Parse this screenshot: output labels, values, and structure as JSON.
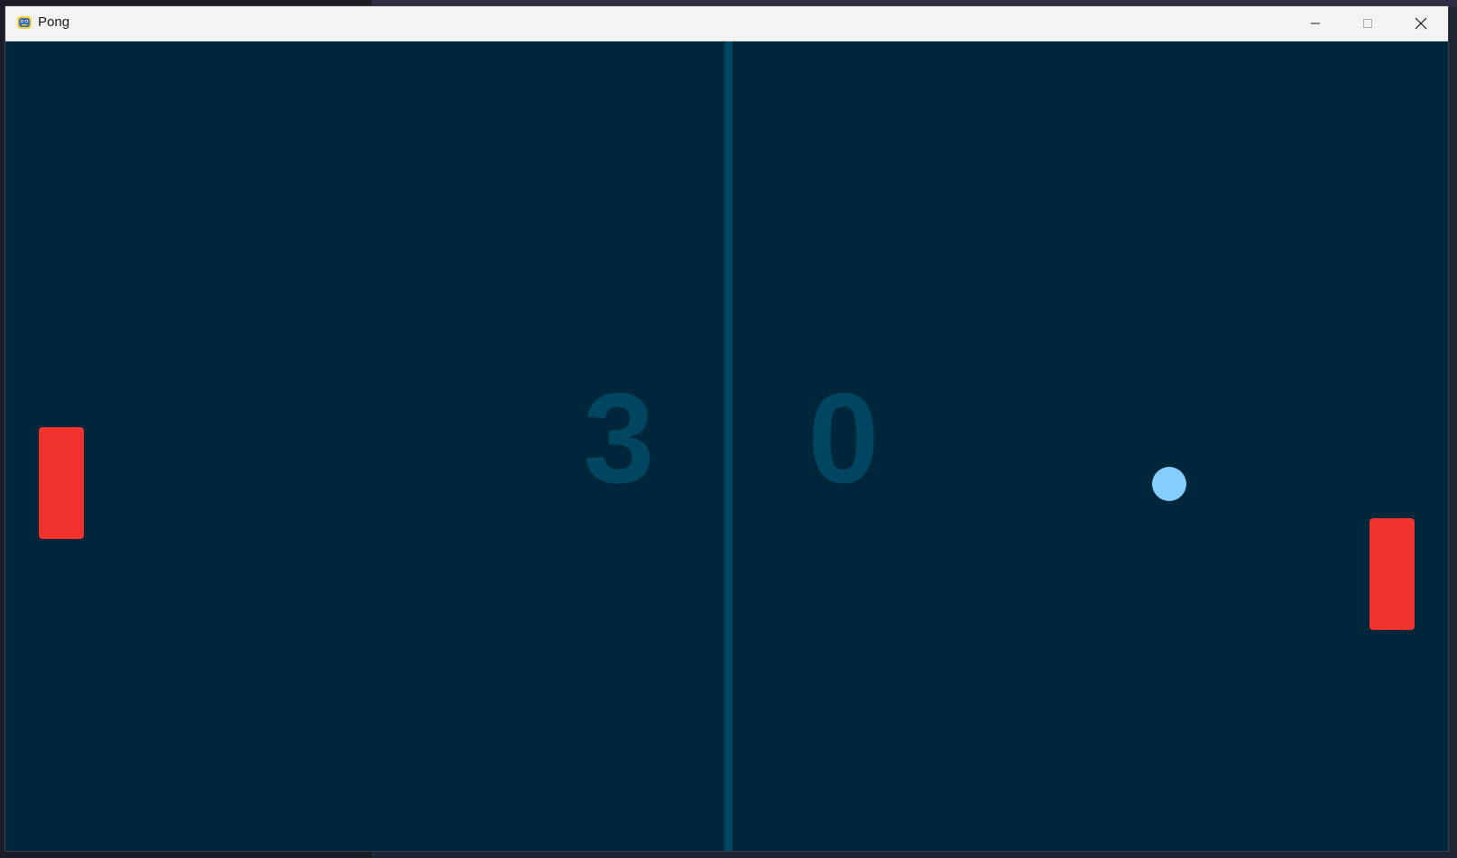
{
  "window": {
    "title": "Pong",
    "icon": "pygame-snake-icon",
    "controls": {
      "minimize": "minimize-icon",
      "maximize": "maximize-icon",
      "close": "close-icon"
    }
  },
  "game": {
    "score_left": "3",
    "score_right": "0",
    "colors": {
      "background": "#00263a",
      "net": "#004660",
      "score": "#004660",
      "paddle": "#f0332e",
      "ball": "#85ccff"
    }
  }
}
